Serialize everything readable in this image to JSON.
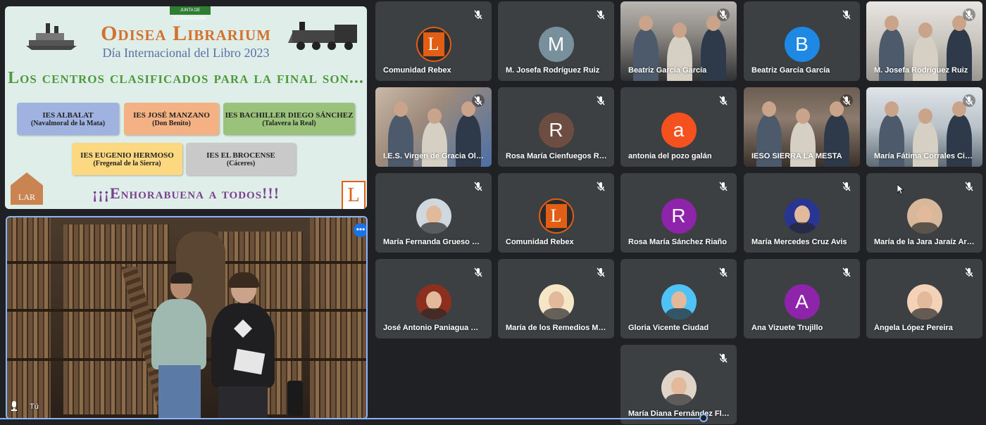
{
  "slide": {
    "header_badge": "JUNTA DE EXTREMADURA",
    "title": "Odisea Librarium",
    "subtitle": "Día Internacional del Libro 2023",
    "heading": "Los centros clasificados para la final son...",
    "schools": [
      {
        "name": "IES ALBALAT",
        "city": "(Navalmoral de la Mata)",
        "color": "#9fb2e0"
      },
      {
        "name": "IES JOSÉ MANZANO",
        "city": "(Don Benito)",
        "color": "#f4b183"
      },
      {
        "name": "IES BACHILLER DIEGO SÁNCHEZ",
        "city": "(Talavera la Real)",
        "color": "#9bc27b"
      },
      {
        "name": "IES EUGENIO HERMOSO",
        "city": "(Fregenal de la Sierra)",
        "color": "#fcd880"
      },
      {
        "name": "IES EL BROCENSE",
        "city": "(Cáceres)",
        "color": "#c9c9c9"
      }
    ],
    "congrats": "¡¡¡Enhorabuena a todos!!!",
    "lar_logo": "LAR",
    "lar_caption": "",
    "logo_letter": "L"
  },
  "self_view": {
    "label": "Tú",
    "menu_icon": "more-options-icon"
  },
  "participants": [
    {
      "name": "Comunidad Rebex",
      "type": "logo",
      "initial": "L",
      "color": "#e05f14"
    },
    {
      "name": "M. Josefa Rodríguez Ruiz",
      "type": "initial",
      "initial": "M",
      "color": "#78909c"
    },
    {
      "name": "Beatriz García García",
      "type": "video"
    },
    {
      "name": "Beatriz García García",
      "type": "initial",
      "initial": "B",
      "color": "#1e88e5"
    },
    {
      "name": "M. Josefa Rodríguez Ruiz",
      "type": "video"
    },
    {
      "name": "I.E.S. Virgen de Gracia Oliva...",
      "type": "video"
    },
    {
      "name": "Rosa María Cienfuegos Ra...",
      "type": "initial",
      "initial": "R",
      "color": "#6d4c41"
    },
    {
      "name": "antonia del pozo galán",
      "type": "initial",
      "initial": "a",
      "color": "#f4511e"
    },
    {
      "name": "IESO SIERRA LA MESTA",
      "type": "video"
    },
    {
      "name": "María Fátima Corrales Cisn...",
      "type": "video"
    },
    {
      "name": "María Fernanda Grueso Dá...",
      "type": "photo",
      "color": "#cfd8dc"
    },
    {
      "name": "Comunidad Rebex",
      "type": "logo",
      "initial": "L",
      "color": "#e05f14"
    },
    {
      "name": "Rosa María Sánchez Riaño",
      "type": "initial",
      "initial": "R",
      "color": "#8e24aa"
    },
    {
      "name": "María Mercedes Cruz Avis",
      "type": "photo",
      "color": "#283593"
    },
    {
      "name": "María de la Jara Jaraíz Arias",
      "type": "photo",
      "color": "#d7b89a"
    },
    {
      "name": "José Antonio Paniagua Mo...",
      "type": "photo",
      "color": "#8d2f1e"
    },
    {
      "name": "María de los Remedios Mar...",
      "type": "photo",
      "color": "#f5e6c8"
    },
    {
      "name": "Gloria Vicente Ciudad",
      "type": "photo",
      "color": "#4fc3f7"
    },
    {
      "name": "Ana Vizuete Trujillo",
      "type": "initial",
      "initial": "A",
      "color": "#8e24aa"
    },
    {
      "name": "Ángela López Pereira",
      "type": "photo",
      "color": "#f3d2b8"
    },
    {
      "name": "María Diana Fernández Flor...",
      "type": "photo",
      "color": "#e0d3c8"
    }
  ]
}
